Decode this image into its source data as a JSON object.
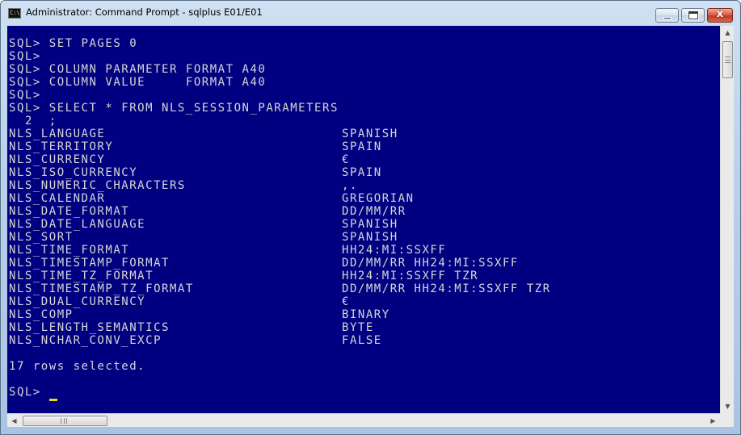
{
  "window": {
    "title": "Administrator: Command Prompt - sqlplus  E01/E01",
    "icon": "cmd-icon",
    "close_glyph": "x"
  },
  "console": {
    "lines": [
      "SQL> SET PAGES 0",
      "SQL>",
      "SQL> COLUMN PARAMETER FORMAT A40",
      "SQL> COLUMN VALUE     FORMAT A40",
      "SQL>",
      "SQL> SELECT * FROM NLS_SESSION_PARAMETERS",
      "  2  ;"
    ],
    "rows": [
      {
        "parameter": "NLS_LANGUAGE",
        "value": "SPANISH"
      },
      {
        "parameter": "NLS_TERRITORY",
        "value": "SPAIN"
      },
      {
        "parameter": "NLS_CURRENCY",
        "value": "€"
      },
      {
        "parameter": "NLS_ISO_CURRENCY",
        "value": "SPAIN"
      },
      {
        "parameter": "NLS_NUMERIC_CHARACTERS",
        "value": ",."
      },
      {
        "parameter": "NLS_CALENDAR",
        "value": "GREGORIAN"
      },
      {
        "parameter": "NLS_DATE_FORMAT",
        "value": "DD/MM/RR"
      },
      {
        "parameter": "NLS_DATE_LANGUAGE",
        "value": "SPANISH"
      },
      {
        "parameter": "NLS_SORT",
        "value": "SPANISH"
      },
      {
        "parameter": "NLS_TIME_FORMAT",
        "value": "HH24:MI:SSXFF"
      },
      {
        "parameter": "NLS_TIMESTAMP_FORMAT",
        "value": "DD/MM/RR HH24:MI:SSXFF"
      },
      {
        "parameter": "NLS_TIME_TZ_FORMAT",
        "value": "HH24:MI:SSXFF TZR"
      },
      {
        "parameter": "NLS_TIMESTAMP_TZ_FORMAT",
        "value": "DD/MM/RR HH24:MI:SSXFF TZR"
      },
      {
        "parameter": "NLS_DUAL_CURRENCY",
        "value": "€"
      },
      {
        "parameter": "NLS_COMP",
        "value": "BINARY"
      },
      {
        "parameter": "NLS_LENGTH_SEMANTICS",
        "value": "BYTE"
      },
      {
        "parameter": "NLS_NCHAR_CONV_EXCP",
        "value": "FALSE"
      }
    ],
    "summary": "17 rows selected.",
    "prompt": "SQL>"
  },
  "colors": {
    "console_bg": "#000080",
    "console_text": "#d6d6d6",
    "cursor": "#e8e000"
  }
}
